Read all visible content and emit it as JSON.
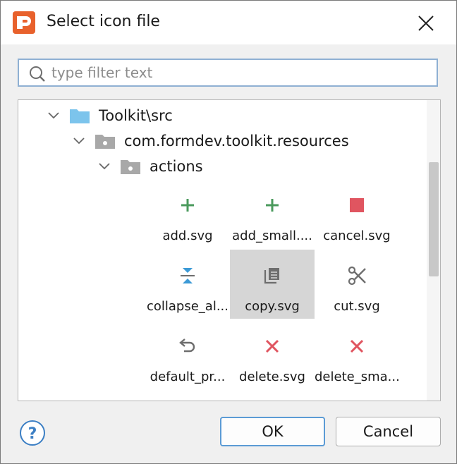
{
  "window": {
    "title": "Select icon file"
  },
  "filter": {
    "placeholder": "type filter text",
    "value": ""
  },
  "tree": {
    "nodes": [
      {
        "label": "Toolkit\\src"
      },
      {
        "label": "com.formdev.toolkit.resources"
      },
      {
        "label": "actions"
      }
    ],
    "icons": [
      {
        "label": "add.svg",
        "icon": "plus-icon",
        "color": "#4a9a5c"
      },
      {
        "label": "add_small....",
        "icon": "plus-icon",
        "color": "#4a9a5c"
      },
      {
        "label": "cancel.svg",
        "icon": "stop-square-icon",
        "color": "#e05560"
      },
      {
        "label": "collapse_al...",
        "icon": "collapse-all-icon",
        "color": "#3c9ad6"
      },
      {
        "label": "copy.svg",
        "icon": "copy-icon",
        "color": "#6e6e6e"
      },
      {
        "label": "cut.svg",
        "icon": "scissors-icon",
        "color": "#6e6e6e"
      },
      {
        "label": "default_pr...",
        "icon": "undo-icon",
        "color": "#6e6e6e"
      },
      {
        "label": "delete.svg",
        "icon": "x-icon",
        "color": "#e05560"
      },
      {
        "label": "delete_sma...",
        "icon": "x-icon",
        "color": "#e05560"
      }
    ],
    "selected_index": 4
  },
  "buttons": {
    "ok": "OK",
    "cancel": "Cancel",
    "help": "?"
  },
  "colors": {
    "accent": "#5b9bd5",
    "app_icon": "#e8612c",
    "folder": "#7cc4ec"
  }
}
